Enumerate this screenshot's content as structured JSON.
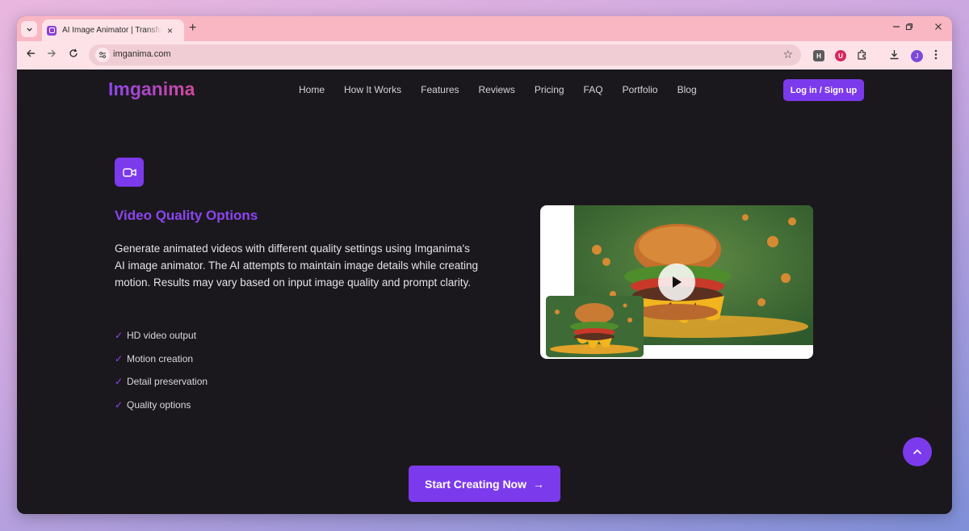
{
  "browser": {
    "tab_title": "AI Image Animator | Transform Images into Videos",
    "tab_list_icon": "chevron-down-icon",
    "new_tab": "+",
    "close_tab": "×",
    "url": "imganima.com",
    "extensions": [
      "H",
      "U"
    ],
    "profile_initial": "J"
  },
  "site": {
    "logo": "Imganima",
    "nav": [
      "Home",
      "How It Works",
      "Features",
      "Reviews",
      "Pricing",
      "FAQ",
      "Portfolio",
      "Blog"
    ],
    "login_label": "Log in / Sign up"
  },
  "feature": {
    "icon": "video-camera-icon",
    "title": "Video Quality Options",
    "description": "Generate animated videos with different quality settings using Imganima's AI image animator. The AI attempts to maintain image details while creating motion. Results may vary based on input image quality and prompt clarity.",
    "check_mark": "✓",
    "checklist": [
      "HD video output",
      "Motion creation",
      "Detail preservation",
      "Quality options"
    ]
  },
  "cta": {
    "label": "Start Creating Now",
    "arrow": "→"
  },
  "colors": {
    "accent": "#7c3aed",
    "heading": "#8b45f0",
    "page_bg": "#1b181d",
    "tab_bg": "#f9b7c3"
  }
}
